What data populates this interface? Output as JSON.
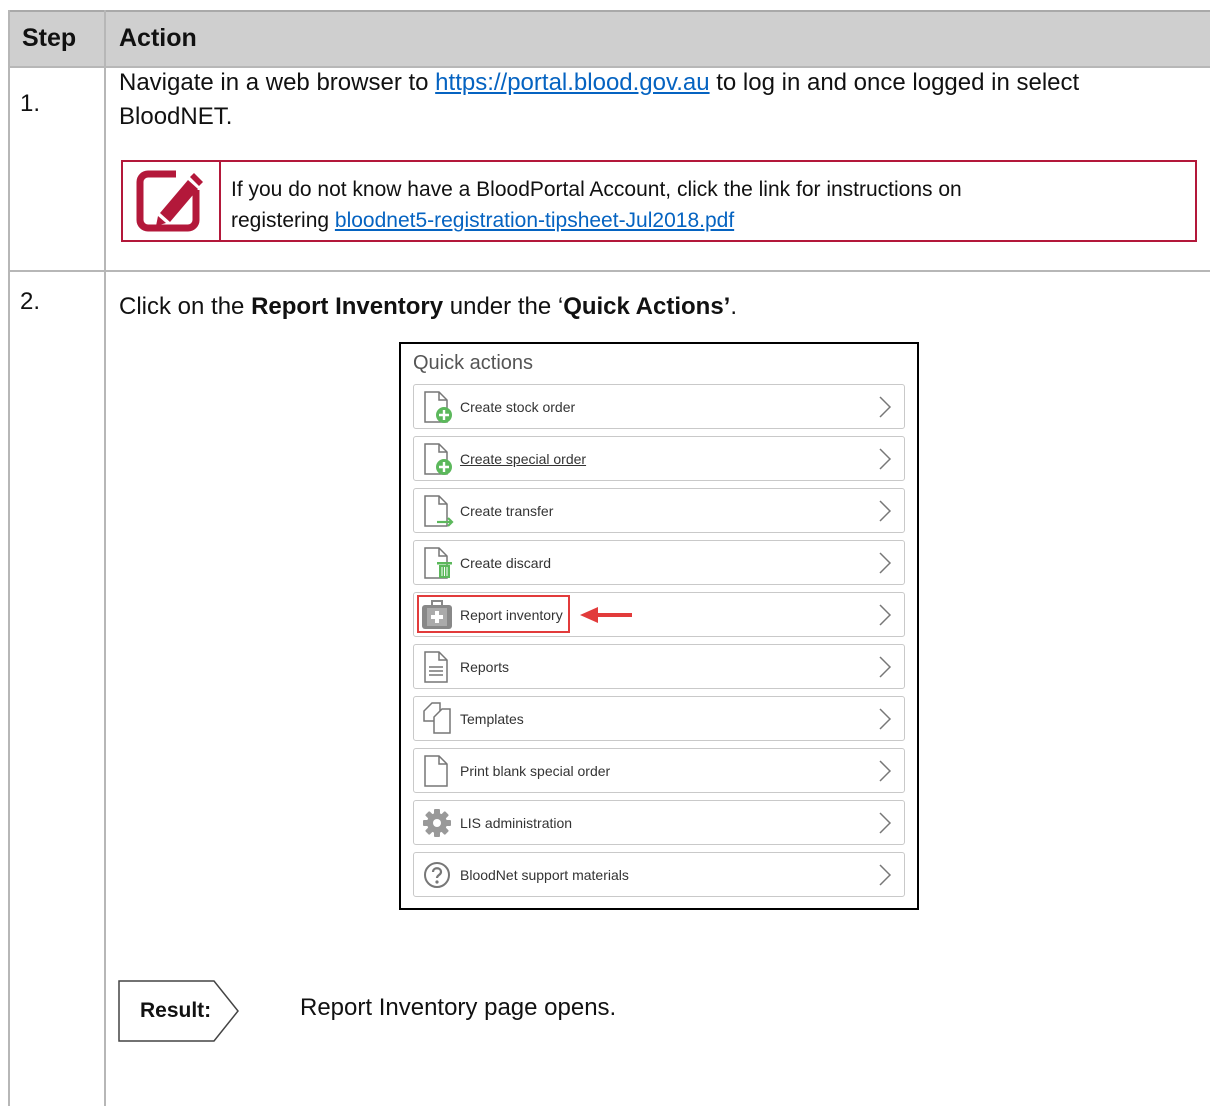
{
  "table": {
    "headers": {
      "step": "Step",
      "action": "Action"
    }
  },
  "step1": {
    "number": "1.",
    "text_before": "Navigate in a web browser to ",
    "link": "https://portal.blood.gov.au",
    "text_after": " to log in and once logged in select BloodNET.",
    "note": {
      "icon": "pencil-edit-icon",
      "text_line1": "If you do not know have a BloodPortal Account, click the link for instructions on",
      "text_line2_prefix": "registering ",
      "link": "bloodnet5-registration-tipsheet-Jul2018.pdf"
    }
  },
  "step2": {
    "number": "2.",
    "text_prefix": "Click on the ",
    "bold1": "Report Inventory",
    "text_mid": " under the ‘",
    "bold2": "Quick Actions’",
    "text_end": ".",
    "quick_actions": {
      "title": "Quick actions",
      "items": [
        {
          "label": "Create stock order",
          "icon": "document-add-icon"
        },
        {
          "label": "Create special order",
          "icon": "document-add-icon"
        },
        {
          "label": "Create transfer",
          "icon": "document-arrow-icon"
        },
        {
          "label": "Create discard",
          "icon": "document-trash-icon"
        },
        {
          "label": "Report inventory",
          "icon": "medical-kit-icon",
          "highlighted": true
        },
        {
          "label": "Reports",
          "icon": "document-lines-icon"
        },
        {
          "label": "Templates",
          "icon": "templates-icon"
        },
        {
          "label": "Print blank special order",
          "icon": "blank-document-icon"
        },
        {
          "label": "LIS administration",
          "icon": "gear-icon"
        },
        {
          "label": "BloodNet support materials",
          "icon": "question-circle-icon"
        }
      ]
    },
    "result": {
      "label": "Result:",
      "text": "Report Inventory page opens."
    }
  },
  "colors": {
    "header_bg": "#cfcfcf",
    "note_border": "#b3183a",
    "link": "#0563c1",
    "highlight": "#e23b3b",
    "icon_green": "#5cb85c"
  }
}
